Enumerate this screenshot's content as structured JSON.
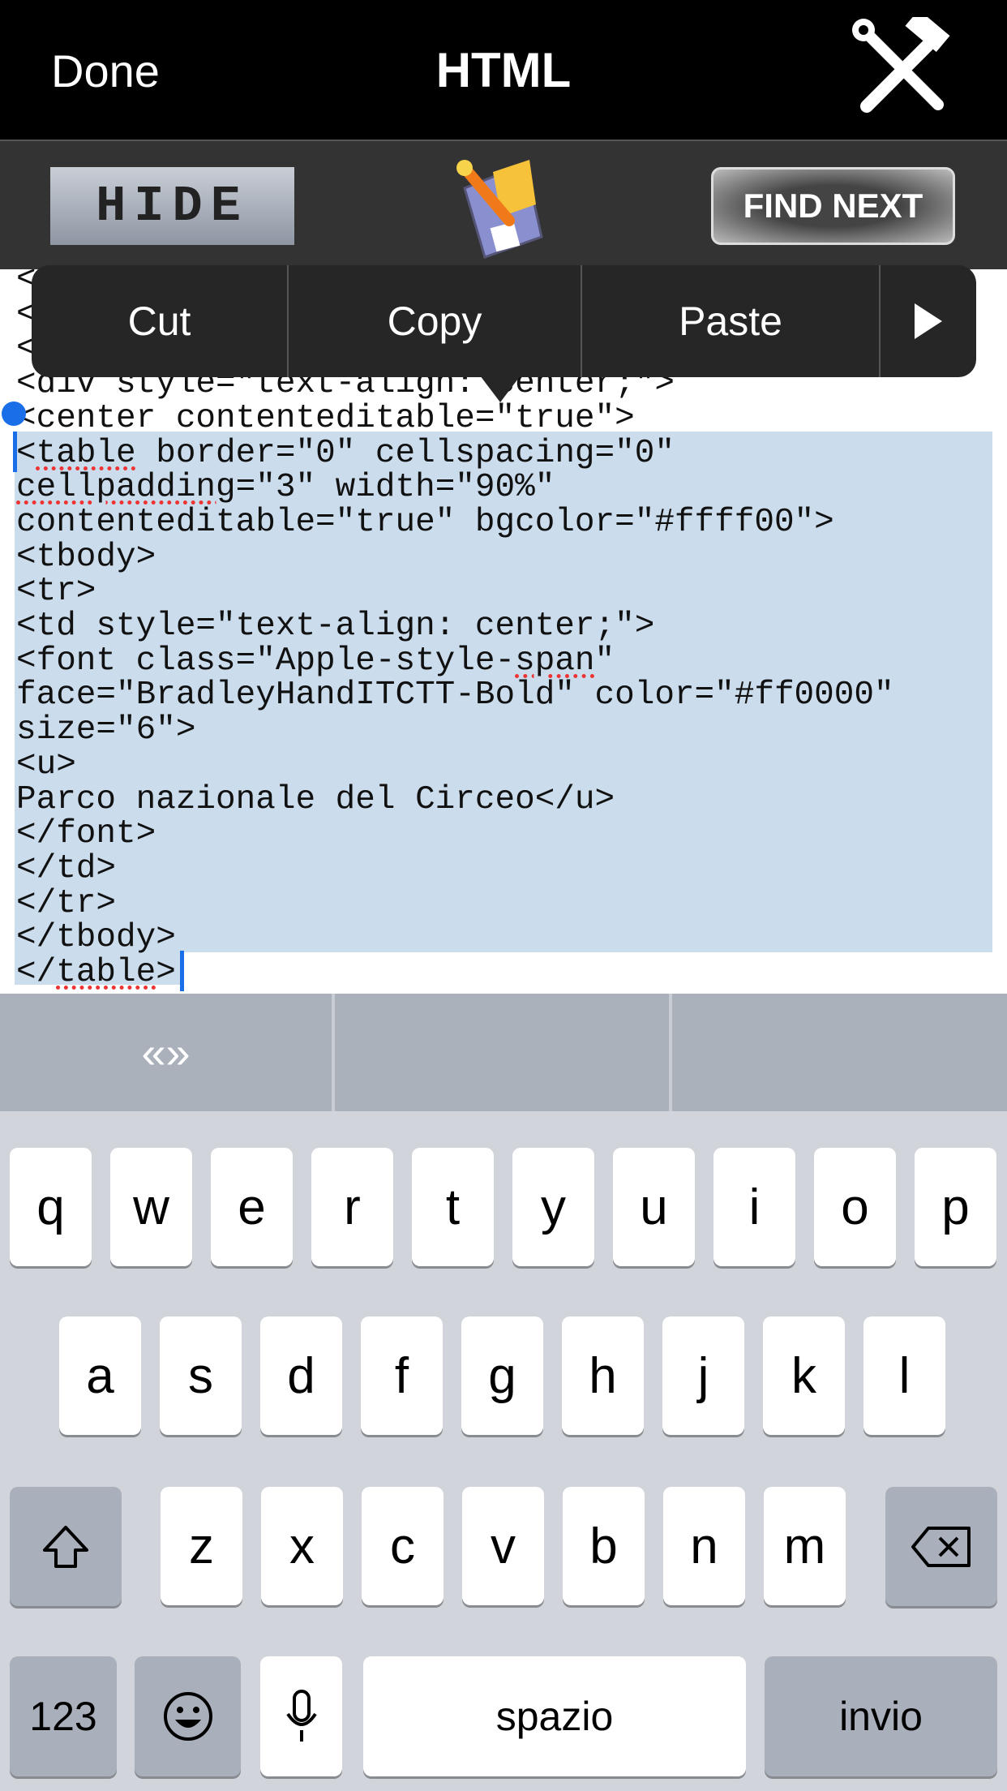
{
  "nav": {
    "done": "Done",
    "title": "HTML",
    "tools_icon": "hammer-wrench-icon"
  },
  "toolbar": {
    "hide": "HIDE",
    "save_icon": "save-disk-icon",
    "find_next": "FIND NEXT"
  },
  "editor": {
    "lines": [
      [
        {
          "t": "<"
        }
      ],
      [
        {
          "t": "<"
        }
      ],
      [
        {
          "t": "<"
        }
      ],
      [
        {
          "t": "<div style=\"text-align: center;\">"
        }
      ],
      [
        {
          "t": "<center contenteditable=\"true\">"
        }
      ],
      [
        {
          "t": "<"
        },
        {
          "t": "table",
          "err": true
        },
        {
          "t": " border=\"0\" cellspacing=\"0\""
        }
      ],
      [
        {
          "t": "cellpadding",
          "err": true
        },
        {
          "t": "=\"3\" width=\"90%\""
        }
      ],
      [
        {
          "t": "contenteditable=\"true\" bgcolor=\"#ffff00\">"
        }
      ],
      [
        {
          "t": "<tbody>"
        }
      ],
      [
        {
          "t": "<tr>"
        }
      ],
      [
        {
          "t": "<td style=\"text-align: center;\">"
        }
      ],
      [
        {
          "t": "<font class=\"Apple-style-"
        },
        {
          "t": "span",
          "err": true
        },
        {
          "t": "\""
        }
      ],
      [
        {
          "t": "face=\"BradleyHandITCTT-Bold\" color=\"#ff0000\""
        }
      ],
      [
        {
          "t": "size=\"6\">"
        }
      ],
      [
        {
          "t": "<u>"
        }
      ],
      [
        {
          "t": "Parco nazionale del Circeo</u>"
        }
      ],
      [
        {
          "t": "</font>"
        }
      ],
      [
        {
          "t": "</td>"
        }
      ],
      [
        {
          "t": "</tr>"
        }
      ],
      [
        {
          "t": "</tbody>"
        }
      ],
      [
        {
          "t": "</"
        },
        {
          "t": "table",
          "err": true
        },
        {
          "t": ">"
        }
      ]
    ]
  },
  "menu": {
    "cut": "Cut",
    "copy": "Copy",
    "paste": "Paste",
    "more_icon": "right-triangle-icon"
  },
  "suggestions": [
    "«»",
    "",
    ""
  ],
  "keyboard": {
    "row1": [
      "q",
      "w",
      "e",
      "r",
      "t",
      "y",
      "u",
      "i",
      "o",
      "p"
    ],
    "row2": [
      "a",
      "s",
      "d",
      "f",
      "g",
      "h",
      "j",
      "k",
      "l"
    ],
    "row3": [
      "z",
      "x",
      "c",
      "v",
      "b",
      "n",
      "m"
    ],
    "numbers": "123",
    "space": "spazio",
    "return": "invio",
    "shift_icon": "shift-arrow-icon",
    "backspace_icon": "backspace-icon",
    "emoji_icon": "emoji-smiley-icon",
    "mic_icon": "microphone-icon"
  },
  "colors": {
    "selection": "#cbdcec",
    "caret": "#1a6ee8",
    "keyboard_bg": "#d1d4da"
  }
}
